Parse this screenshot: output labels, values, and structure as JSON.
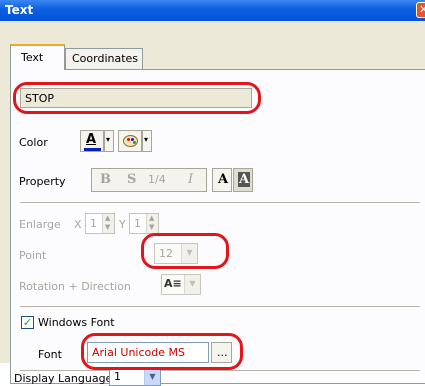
{
  "window": {
    "title": "Text",
    "close_glyph": "✕"
  },
  "tabs": {
    "text_label": "Text",
    "coordinates_label": "Coordinates"
  },
  "text_field": {
    "value": "STOP"
  },
  "color": {
    "label": "Color",
    "font_color_glyph": "A",
    "arrow": "▾",
    "palette_icon": "palette-icon"
  },
  "property": {
    "label": "Property",
    "bold": "B",
    "shadow": "S",
    "quarter": "1/4",
    "italic": "I",
    "a_normal": "A",
    "a_highlight": "A"
  },
  "enlarge": {
    "label": "Enlarge",
    "x_label": "X",
    "x_value": "1",
    "y_label": "Y",
    "y_value": "1"
  },
  "point": {
    "label": "Point",
    "value": "12"
  },
  "rotation": {
    "label": "Rotation + Direction",
    "glyph": "A≡"
  },
  "windows_font": {
    "label": "Windows Font",
    "checked": true,
    "check_glyph": "✓"
  },
  "font": {
    "label": "Font",
    "value": "Arial Unicode MS",
    "browse_label": "..."
  },
  "display_language": {
    "label": "Display Language",
    "value": "1"
  },
  "colors": {
    "annotation_red": "#e3151a",
    "titlebar_blue": "#0a5fe0",
    "font_value_red": "#d00000"
  }
}
